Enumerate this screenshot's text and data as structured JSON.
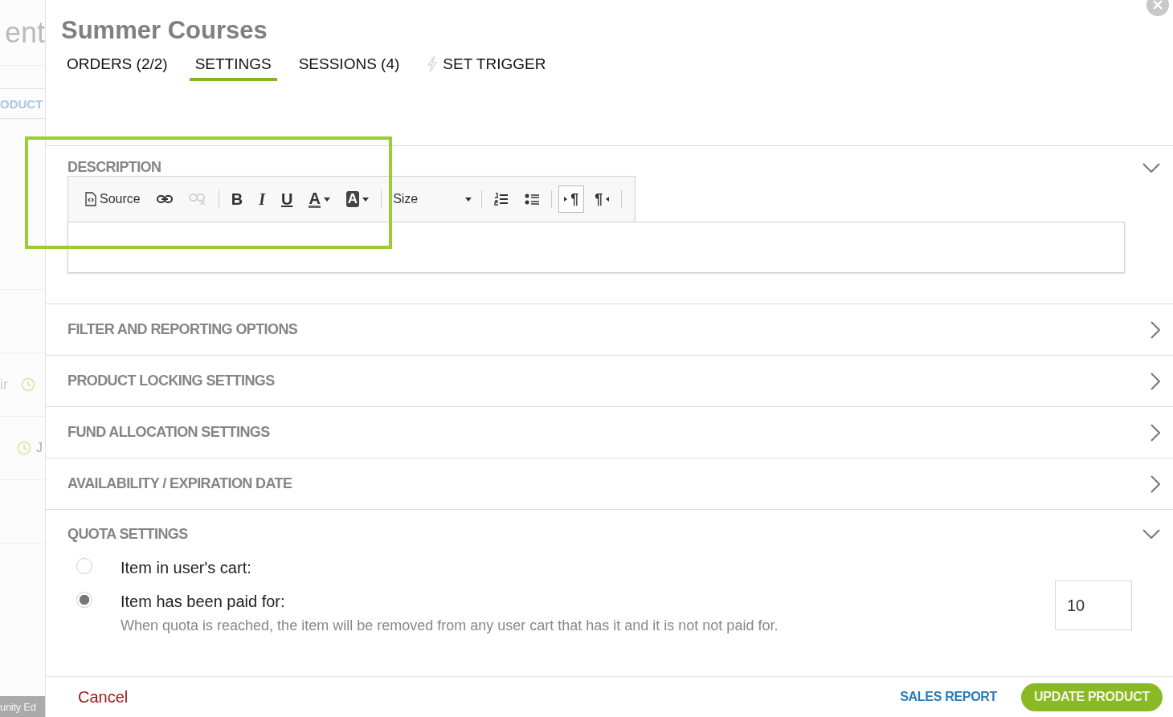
{
  "background": {
    "texts": [
      {
        "kind": "heading",
        "text": "ent"
      },
      {
        "kind": "tab",
        "text": "ODUCT"
      },
      {
        "kind": "clock-after",
        "text": "ir"
      },
      {
        "kind": "clock-before",
        "text": "J"
      },
      {
        "kind": "footer",
        "text": "unity Ed"
      }
    ]
  },
  "dialog": {
    "title": "Summer Courses",
    "tabs": [
      {
        "label": "ORDERS (2/2)",
        "selected": false,
        "kind": "plain"
      },
      {
        "label": "SETTINGS",
        "selected": true,
        "kind": "plain"
      },
      {
        "label": "SESSIONS (4)",
        "selected": false,
        "kind": "plain"
      },
      {
        "label": "SET TRIGGER",
        "selected": false,
        "kind": "bolt"
      }
    ]
  },
  "sections": [
    {
      "kind": "editor",
      "title": "DESCRIPTION",
      "expanded": true,
      "toolbar": [
        {
          "kind": "source",
          "label": "Source",
          "disabled": false
        },
        {
          "kind": "link",
          "disabled": false
        },
        {
          "kind": "unlink",
          "disabled": true
        },
        {
          "kind": "separator"
        },
        {
          "kind": "bold",
          "glyph": "B",
          "disabled": false
        },
        {
          "kind": "italic",
          "glyph": "I",
          "disabled": false
        },
        {
          "kind": "underline",
          "glyph": "U",
          "disabled": false
        },
        {
          "kind": "textcolor",
          "glyph": "A",
          "disabled": false
        },
        {
          "kind": "bgcolor",
          "glyph": "A",
          "disabled": false
        },
        {
          "kind": "separator"
        },
        {
          "kind": "dropdown",
          "label": "Size"
        },
        {
          "kind": "separator"
        },
        {
          "kind": "numbered",
          "disabled": false
        },
        {
          "kind": "bulleted",
          "disabled": false
        },
        {
          "kind": "separator"
        },
        {
          "kind": "ltr",
          "glyph": "¶",
          "selected": true
        },
        {
          "kind": "rtl",
          "glyph": "¶",
          "selected": false
        },
        {
          "kind": "separator"
        }
      ]
    },
    {
      "kind": "plain",
      "title": "FILTER AND REPORTING OPTIONS",
      "expanded": false
    },
    {
      "kind": "plain",
      "title": "PRODUCT LOCKING SETTINGS",
      "expanded": false
    },
    {
      "kind": "plain",
      "title": "FUND ALLOCATION SETTINGS",
      "expanded": false
    },
    {
      "kind": "plain",
      "title": "AVAILABILITY / EXPIRATION DATE",
      "expanded": false
    },
    {
      "kind": "quota",
      "title": "QUOTA SETTINGS",
      "expanded": true,
      "options": [
        {
          "label": "Item in user's cart:",
          "selected": false
        },
        {
          "label": "Item has been paid for:",
          "selected": true,
          "note": "When quota is reached, the item will be removed from any user cart that has it and it is not not paid for.",
          "value": "10"
        }
      ]
    }
  ],
  "footer": {
    "cancel": "Cancel",
    "link": "SALES REPORT",
    "primary": "UPDATE PRODUCT"
  }
}
